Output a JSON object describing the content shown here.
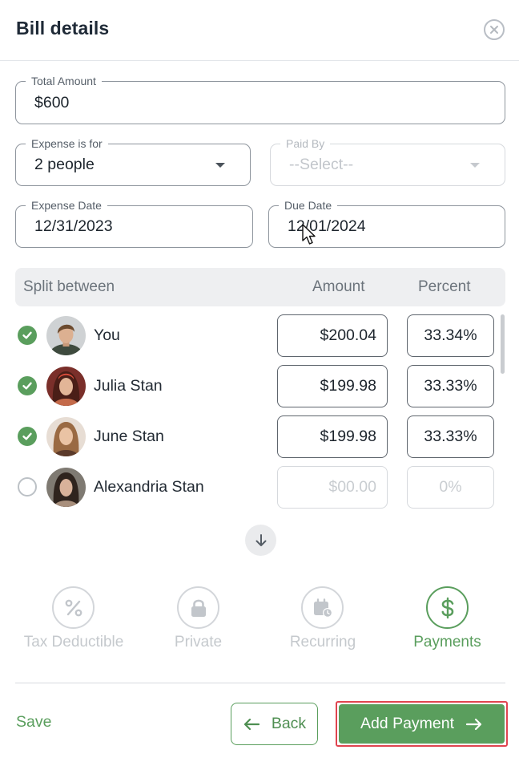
{
  "dialog": {
    "title": "Bill details"
  },
  "fields": {
    "total_amount": {
      "label": "Total Amount",
      "value": "$600"
    },
    "expense_for": {
      "label": "Expense is for",
      "value": "2 people"
    },
    "paid_by": {
      "label": "Paid By",
      "placeholder": "--Select--"
    },
    "expense_date": {
      "label": "Expense Date",
      "value": "12/31/2023"
    },
    "due_date": {
      "label": "Due Date",
      "value": "12/01/2024"
    }
  },
  "split": {
    "headers": {
      "name": "Split between",
      "amount": "Amount",
      "percent": "Percent"
    },
    "rows": [
      {
        "name": "You",
        "amount": "$200.04",
        "percent": "33.34%",
        "checked": true
      },
      {
        "name": "Julia Stan",
        "amount": "$199.98",
        "percent": "33.33%",
        "checked": true
      },
      {
        "name": "June Stan",
        "amount": "$199.98",
        "percent": "33.33%",
        "checked": true
      },
      {
        "name": "Alexandria Stan",
        "amount": "$00.00",
        "percent": "0%",
        "checked": false
      }
    ]
  },
  "options": [
    {
      "label": "Tax Deductible",
      "icon": "percent-icon",
      "active": false
    },
    {
      "label": "Private",
      "icon": "lock-icon",
      "active": false
    },
    {
      "label": "Recurring",
      "icon": "calendar-clock-icon",
      "active": false
    },
    {
      "label": "Payments",
      "icon": "dollar-icon",
      "active": true
    }
  ],
  "footer": {
    "save_label": "Save",
    "back_label": "Back",
    "add_payment_label": "Add Payment"
  },
  "colors": {
    "accent": "#5a9e5d",
    "highlight_border": "#e0444f"
  }
}
